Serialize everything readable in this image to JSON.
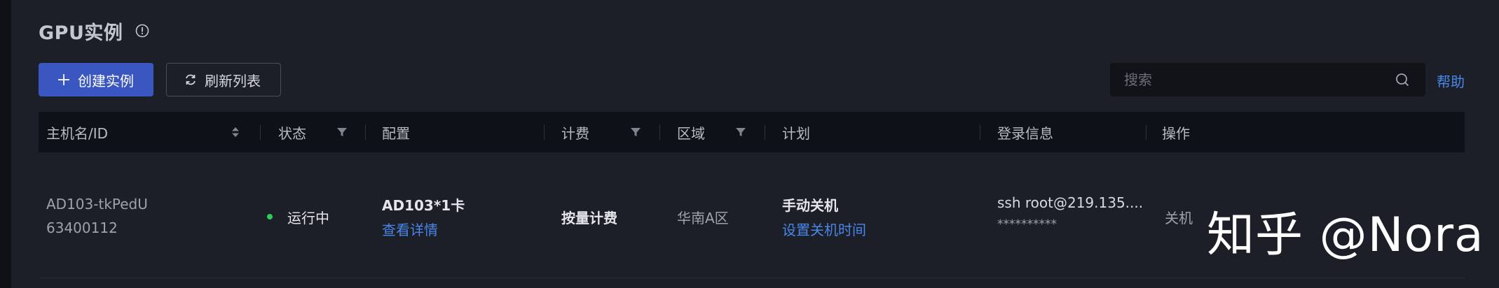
{
  "header": {
    "title": "GPU实例",
    "info_icon": "info-circle-icon"
  },
  "toolbar": {
    "create_label": "创建实例",
    "refresh_label": "刷新列表",
    "search_placeholder": "搜索",
    "help_label": "帮助"
  },
  "table": {
    "columns": [
      "主机名/ID",
      "状态",
      "配置",
      "计费",
      "区域",
      "计划",
      "登录信息",
      "操作"
    ],
    "rows": [
      {
        "hostname": "AD103-tkPedU",
        "id": "63400112",
        "status": "运行中",
        "config": "AD103*1卡",
        "config_link": "查看详情",
        "billing": "按量计费",
        "region": "华南A区",
        "plan": "手动关机",
        "plan_link": "设置关机时间",
        "login_cmd": "ssh root@219.135....",
        "login_password": "**********",
        "action": "关机"
      }
    ]
  },
  "watermark": "知乎 @Nora",
  "colors": {
    "primary": "#3a56c0",
    "link": "#4a86e8",
    "status_running": "#2ecc5a",
    "background": "#1c1f28"
  }
}
